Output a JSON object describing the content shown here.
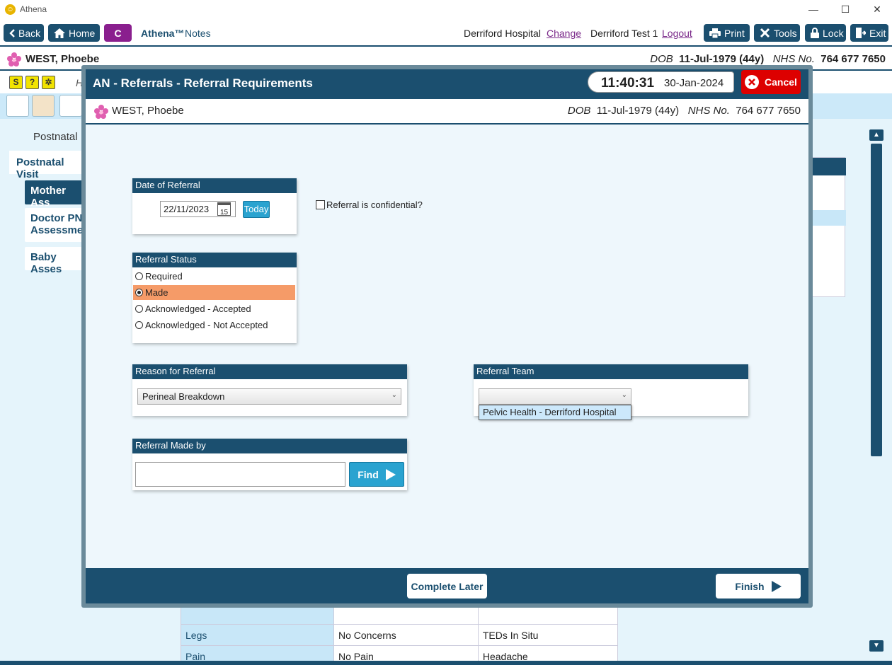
{
  "window": {
    "title": "Athena",
    "minimize": "—",
    "maximize": "☐",
    "close": "✕"
  },
  "toolbar": {
    "back": "Back",
    "home": "Home",
    "c_label": "C",
    "app_brand": "Athena™",
    "app_notes": "Notes",
    "hospital": "Derriford Hospital",
    "change": "Change",
    "user": "Derriford Test 1",
    "logout": "Logout",
    "print": "Print",
    "tools": "Tools",
    "lock": "Lock",
    "exit": "Exit"
  },
  "patient": {
    "name": "WEST, Phoebe",
    "dob_label": "DOB",
    "dob": "11-Jul-1979 (44y)",
    "nhs_label": "NHS No.",
    "nhs": "764 677 7650"
  },
  "background": {
    "h_letter": "H",
    "section_title": "Postnatal",
    "sidebar": [
      "Postnatal Visit",
      "Mother Ass",
      "Doctor PN Assessmen",
      "Baby Asses"
    ],
    "table": [
      {
        "label": "Legs",
        "col1": "No Concerns",
        "col2": "TEDs In Situ"
      },
      {
        "label": "Pain",
        "col1": "No Pain",
        "col2": "Headache"
      }
    ]
  },
  "modal": {
    "title": "AN - Referrals - Referral Requirements",
    "time": "11:40:31",
    "date": "30-Jan-2024",
    "cancel": "Cancel",
    "date_of_referral": {
      "header": "Date of Referral",
      "value": "22/11/2023",
      "calendar_day": "15",
      "today": "Today"
    },
    "confidential_label": "Referral is confidential?",
    "status": {
      "header": "Referral Status",
      "options": [
        "Required",
        "Made",
        "Acknowledged - Accepted",
        "Acknowledged - Not Accepted"
      ],
      "selected": "Made"
    },
    "reason": {
      "header": "Reason for Referral",
      "value": "Perineal Breakdown"
    },
    "team": {
      "header": "Referral Team",
      "value": "",
      "dropdown_option": "Pelvic Health - Derriford Hospital"
    },
    "made_by": {
      "header": "Referral Made by",
      "value": "",
      "find": "Find"
    },
    "footer": {
      "complete_later": "Complete Later",
      "finish": "Finish"
    }
  },
  "colors": {
    "primary": "#1b4f6f",
    "accent": "#2aa3d0",
    "selected": "#f59b68",
    "cancel": "#dd0000",
    "c_badge": "#8a1f8e"
  }
}
